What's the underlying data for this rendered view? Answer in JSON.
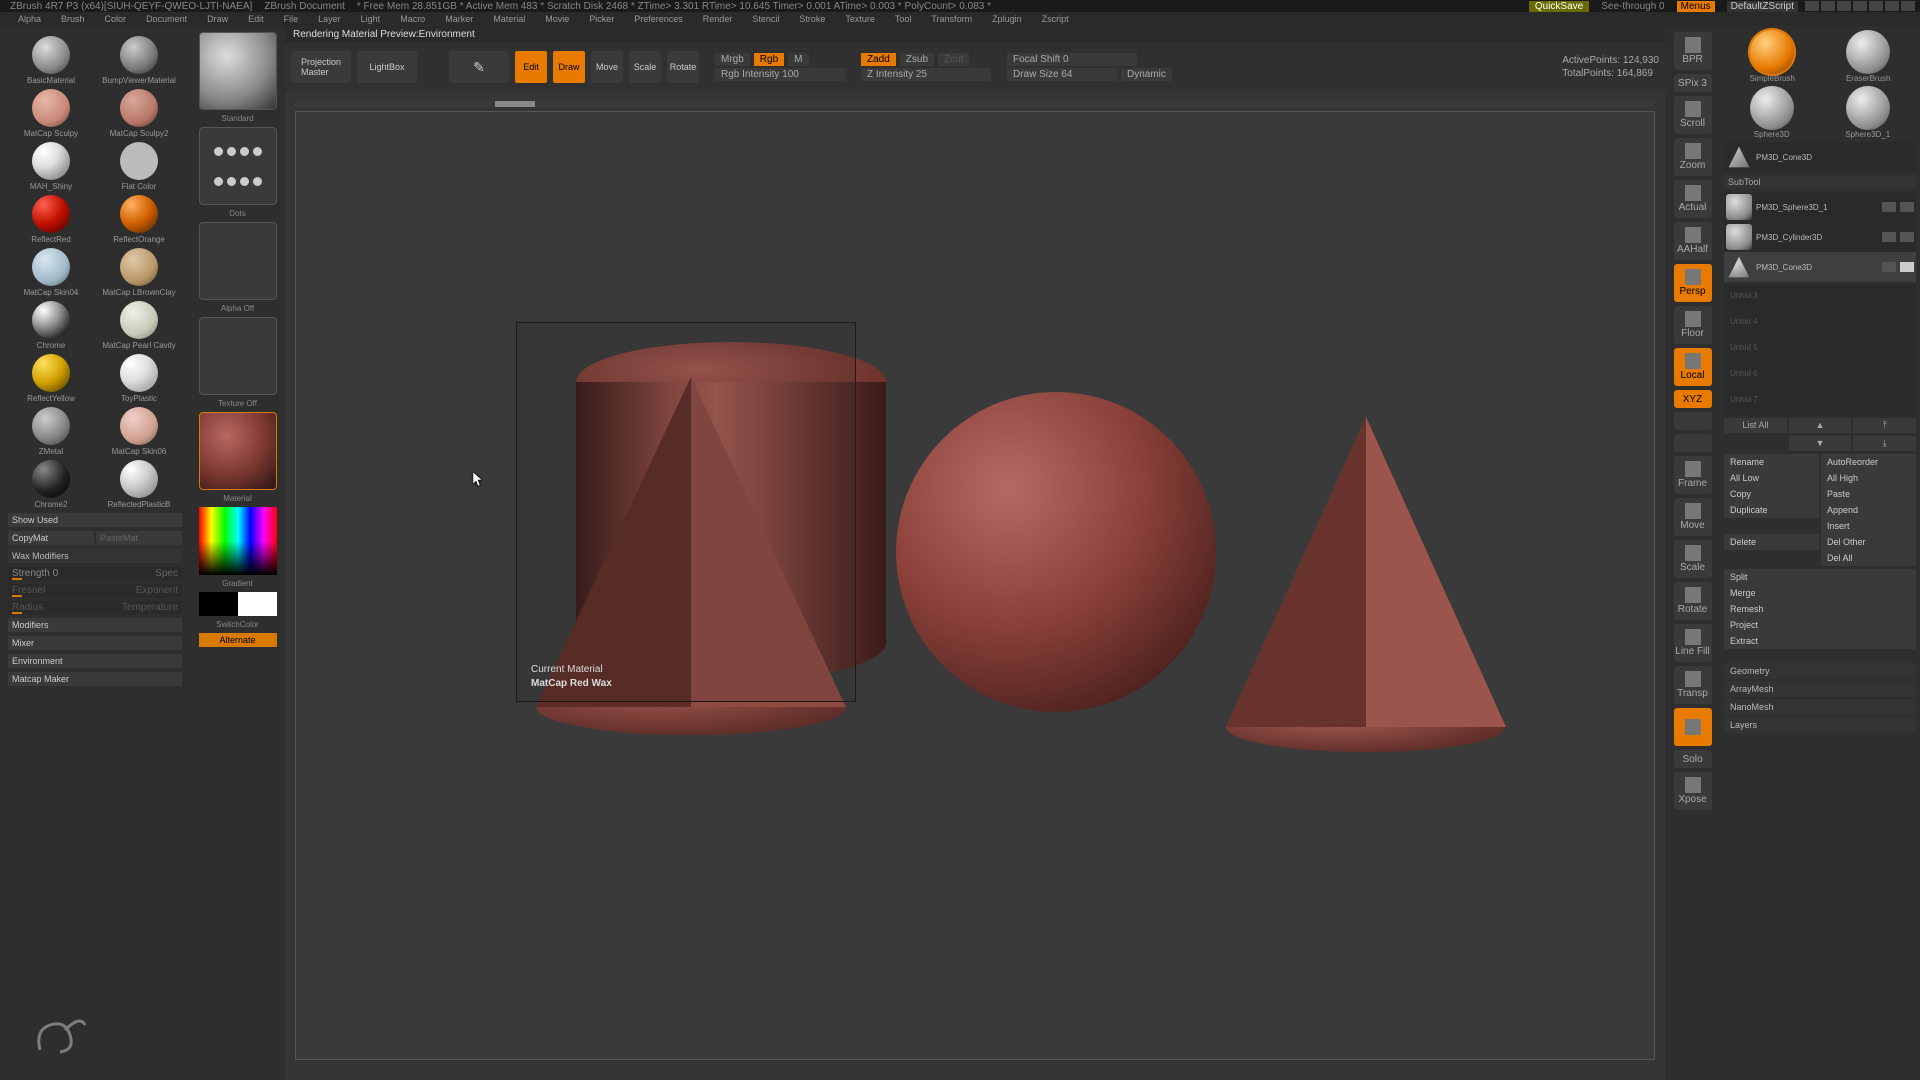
{
  "titlebar": {
    "app": "ZBrush 4R7 P3 (x64)[SIUH-QEYF-QWEO-LJTI-NAEA]",
    "doc": "ZBrush Document",
    "stats": "* Free Mem 28.851GB * Active Mem 483 * Scratch Disk 2468 * ZTime> 3.301 RTime> 10.645 Timer> 0.001 ATime> 0.003 * PolyCount> 0.083 *",
    "quicksave": "QuickSave",
    "seethrough": "See-through 0",
    "menus": "Menus",
    "dzscript": "DefaultZScript"
  },
  "menubar": [
    "Alpha",
    "Brush",
    "Color",
    "Document",
    "Draw",
    "Edit",
    "File",
    "Layer",
    "Light",
    "Macro",
    "Marker",
    "Material",
    "Movie",
    "Picker",
    "Preferences",
    "Render",
    "Stencil",
    "Stroke",
    "Texture",
    "Tool",
    "Transform",
    "Zplugin",
    "Zscript"
  ],
  "materials": [
    {
      "name": "BasicMaterial",
      "bg": "radial-gradient(circle at 35% 30%, #ddd, #888 60%, #333)"
    },
    {
      "name": "BumpViewerMaterial",
      "bg": "radial-gradient(circle at 35% 30%, #ccc, #777 60%, #222)"
    },
    {
      "name": "MatCap Sculpy",
      "bg": "radial-gradient(circle at 35% 30%, #e8b8a8, #c88878 60%, #644038)"
    },
    {
      "name": "MatCap Sculpy2",
      "bg": "radial-gradient(circle at 35% 30%, #d8a898, #b87868 60%, #543028)"
    },
    {
      "name": "MAH_Shiny",
      "bg": "radial-gradient(circle at 30% 25%, #fff, #ddd 40%, #666)"
    },
    {
      "name": "Flat Color",
      "bg": "#bbb"
    },
    {
      "name": "ReflectRed",
      "bg": "radial-gradient(circle at 30% 25%, #ff6050, #c01000 50%, #400000)"
    },
    {
      "name": "ReflectOrange",
      "bg": "radial-gradient(circle at 30% 25%, #ffb060, #d06000 50%, #402000)"
    },
    {
      "name": "MatCap Skin04",
      "bg": "radial-gradient(circle at 35% 30%, #d8e8f0, #a0b8c8 60%, #506068)"
    },
    {
      "name": "MatCap LBrownClay",
      "bg": "radial-gradient(circle at 35% 30%, #e0c8a8, #b89868 60%, #584830)"
    },
    {
      "name": "Chrome",
      "bg": "radial-gradient(circle at 30% 25%, #fff, #999 40%, #222 80%, #666)"
    },
    {
      "name": "MatCap Pearl Cavity",
      "bg": "radial-gradient(circle at 35% 30%, #f0f0e8, #c8c8b8 60%, #787868)"
    },
    {
      "name": "ReflectYellow",
      "bg": "radial-gradient(circle at 30% 25%, #ffe060, #d0a000 50%, #403000)"
    },
    {
      "name": "ToyPlastic",
      "bg": "radial-gradient(circle at 30% 25%, #fff, #ddd 45%, #888)"
    },
    {
      "name": "ZMetal",
      "bg": "radial-gradient(circle at 35% 30%, #ccc, #888 55%, #333)"
    },
    {
      "name": "MatCap Skin06",
      "bg": "radial-gradient(circle at 35% 30%, #f0d0c8, #d0a090 60%, #705048)"
    },
    {
      "name": "Chrome2",
      "bg": "radial-gradient(circle at 30% 25%, #888, #222 55%, #000)"
    },
    {
      "name": "ReflectedPlasticB",
      "bg": "radial-gradient(circle at 30% 25%, #fff, #ccc 45%, #777)"
    }
  ],
  "left": {
    "showused": "Show Used",
    "copymat": "CopyMat",
    "pastemat": "PasteMat",
    "waxmod": "Wax Modifiers",
    "strength": "Strength 0",
    "spec": "Spec",
    "fresnel": "Fresnel",
    "exponent": "Exponent",
    "radius": "Radius",
    "temperature": "Temperature",
    "modifiers": "Modifiers",
    "mixer": "Mixer",
    "environment": "Environment",
    "matcapmaker": "Matcap Maker"
  },
  "toolcol": {
    "standard": "Standard",
    "dots": "Dots",
    "alphaoff": "Alpha Off",
    "textureoff": "Texture Off",
    "material": "Material",
    "gradient": "Gradient",
    "switchcolor": "SwitchColor",
    "alternate": "Alternate"
  },
  "status": "Rendering Material Preview:Environment",
  "toptools": {
    "projection": "Projection\nMaster",
    "lightbox": "LightBox",
    "quicksketch": "Quick\nSketch",
    "edit": "Edit",
    "draw": "Draw",
    "move": "Move",
    "scale": "Scale",
    "rotate": "Rotate",
    "mrgb": "Mrgb",
    "rgb": "Rgb",
    "m": "M",
    "rgbint": "Rgb Intensity 100",
    "zadd": "Zadd",
    "zsub": "Zsub",
    "zcut": "Zcut",
    "zint": "Z Intensity 25",
    "focal": "Focal Shift 0",
    "drawsize": "Draw Size 64",
    "dynamic": "Dynamic",
    "active": "ActivePoints: 124,930",
    "total": "TotalPoints: 164,869"
  },
  "tooltip": {
    "line1": "Current Material",
    "line2": "MatCap Red Wax"
  },
  "rightnav": [
    {
      "label": "BPR",
      "orange": false
    },
    {
      "label": "SPix 3",
      "orange": false,
      "short": true
    },
    {
      "label": "Scroll",
      "orange": false
    },
    {
      "label": "Zoom",
      "orange": false
    },
    {
      "label": "Actual",
      "orange": false
    },
    {
      "label": "AAHalf",
      "orange": false
    },
    {
      "label": "Persp",
      "orange": true
    },
    {
      "label": "Floor",
      "orange": false
    },
    {
      "label": "Local",
      "orange": true
    },
    {
      "label": "XYZ",
      "orange": true,
      "short": true
    },
    {
      "label": "",
      "orange": false,
      "short": true
    },
    {
      "label": "",
      "orange": false,
      "short": true
    },
    {
      "label": "Frame",
      "orange": false
    },
    {
      "label": "Move",
      "orange": false
    },
    {
      "label": "Scale",
      "orange": false
    },
    {
      "label": "Rotate",
      "orange": false
    },
    {
      "label": "Line Fill",
      "orange": false
    },
    {
      "label": "Transp",
      "orange": false
    },
    {
      "label": "",
      "orange": true
    },
    {
      "label": "Solo",
      "orange": false,
      "short": true
    },
    {
      "label": "Xpose",
      "orange": false
    }
  ],
  "rightpanel": {
    "brushes": [
      {
        "name": "SimpleBrush",
        "orange": true
      },
      {
        "name": "EraserBrush",
        "orange": false
      }
    ],
    "tools": [
      {
        "name": "Sphere3D"
      },
      {
        "name": "Sphere3D_1"
      }
    ],
    "cone_tool": "PM3D_Cone3D",
    "subtool_hdr": "SubTool",
    "subtools": [
      {
        "name": "PM3D_Sphere3D_1",
        "active": false,
        "thumb": "sphere"
      },
      {
        "name": "PM3D_Cylinder3D",
        "active": false,
        "thumb": "cyl"
      },
      {
        "name": "PM3D_Cone3D",
        "active": true,
        "thumb": "cone"
      }
    ],
    "empty_slots": [
      "Unhid 3",
      "Unhid 4",
      "Unhid 5",
      "Unhid 6",
      "Unhid 7"
    ],
    "listall": "List All",
    "buttons": [
      [
        "Rename",
        "AutoReorder"
      ],
      [
        "All Low",
        "All High"
      ],
      [
        "Copy",
        "Paste"
      ],
      [
        "Duplicate",
        "Append"
      ],
      [
        "",
        "Insert"
      ],
      [
        "Delete",
        "Del Other"
      ],
      [
        "",
        "Del All"
      ]
    ],
    "sections": [
      "Split",
      "Merge",
      "Remesh",
      "Project",
      "Extract"
    ],
    "sections2": [
      "Geometry",
      "ArrayMesh",
      "NanoMesh",
      "Layers"
    ]
  }
}
